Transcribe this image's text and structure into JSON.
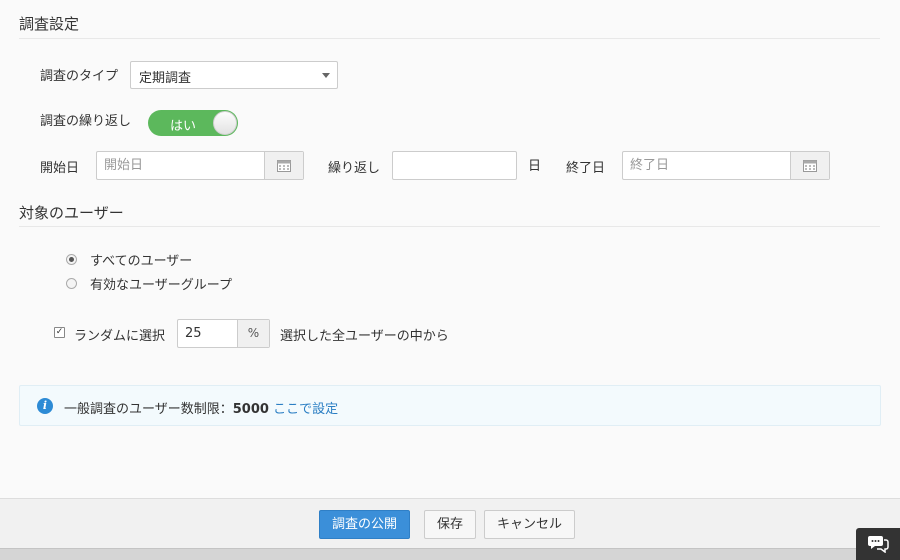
{
  "survey_settings": {
    "title": "調査設定",
    "type_label": "調査のタイプ",
    "type_value": "定期調査",
    "repeat_label": "調査の繰り返し",
    "repeat_toggle": "はい",
    "start_label": "開始日",
    "start_placeholder": "開始日",
    "repeat_every_label": "繰り返し",
    "repeat_every_value": "",
    "day_unit": "日",
    "end_label": "終了日",
    "end_placeholder": "終了日"
  },
  "target_users": {
    "title": "対象のユーザー",
    "options": [
      {
        "label": "すべてのユーザー",
        "checked": true
      },
      {
        "label": "有効なユーザーグループ",
        "checked": false
      }
    ],
    "random_label": "ランダムに選択",
    "random_checked": true,
    "random_value": "25",
    "random_unit": "%",
    "random_suffix": "選択した全ユーザーの中から"
  },
  "info": {
    "text": "一般調査のユーザー数制限：",
    "limit": "5000",
    "link": "ここで設定"
  },
  "footer": {
    "publish_label": "調査の公開",
    "save_label": "保存",
    "cancel_label": "キャンセル"
  },
  "colors": {
    "toggle_on": "#5cb85c",
    "primary": "#3b8fd9",
    "info_icon": "#2d8bd5",
    "link": "#2a7ec3"
  }
}
